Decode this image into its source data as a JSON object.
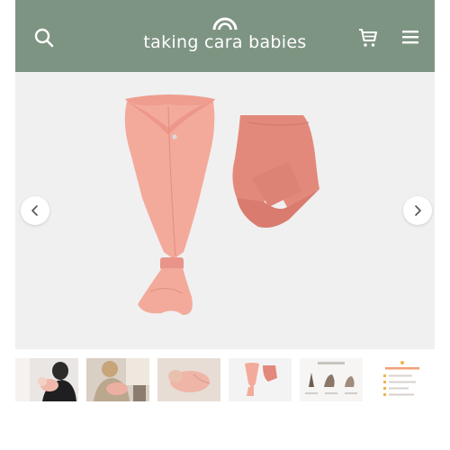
{
  "header": {
    "brand": "taking cara babies",
    "background": "#7e9482",
    "search_icon": "search-icon",
    "cart_icon": "cart-icon",
    "menu_icon": "hamburger-menu-icon"
  },
  "gallery": {
    "main_image": "swaddle-and-matching-pink-sleeve-product-photo",
    "swaddle_color": "#f2a89a",
    "sleeve_color": "#e08878",
    "prev_icon": "chevron-left-icon",
    "next_icon": "chevron-right-icon"
  },
  "thumbnails": [
    "mother-holding-baby-photo",
    "caregiver-swaddling-baby-photo",
    "swaddled-baby-sleeping-photo",
    "swaddle-product-photo",
    "how-to-swaddle-steps-graphic",
    "swaddle-checklist-graphic"
  ]
}
